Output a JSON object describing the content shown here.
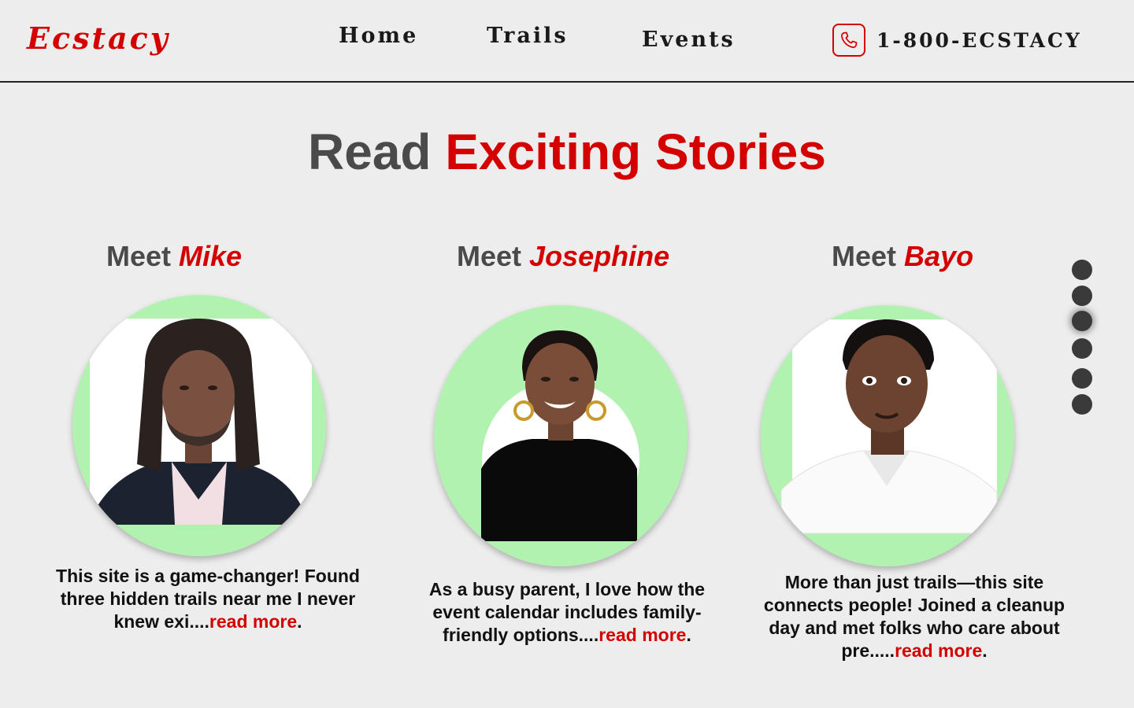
{
  "header": {
    "logo": "Ecstacy",
    "nav": [
      {
        "label": "Home"
      },
      {
        "label": "Trails"
      },
      {
        "label": "Events"
      }
    ],
    "phone": {
      "icon": "phone-icon",
      "number": "1-800-ECSTACY"
    }
  },
  "title": {
    "part1": "Read",
    "part2": "Exciting Stories"
  },
  "stories": [
    {
      "prefix": "Meet",
      "name": "Mike",
      "text": "This site is a game-changer! Found three hidden trails near me I never knew exi....",
      "more": "read more",
      "end": "."
    },
    {
      "prefix": "Meet",
      "name": "Josephine",
      "text": "As a busy parent, I love how the event calendar includes family-friendly options....",
      "more": "read more",
      "end": "."
    },
    {
      "prefix": "Meet",
      "name": "Bayo",
      "text": "More than just trails—this site connects people! Joined a cleanup day and met folks who care about pre.....",
      "more": "read more",
      "end": "."
    }
  ],
  "carousel": {
    "count": 6,
    "active_index": 2
  },
  "colors": {
    "accent": "#d40000",
    "text_dark": "#4a4a4a",
    "portrait_bg": "#b2f2b0",
    "background": "#ededed"
  }
}
